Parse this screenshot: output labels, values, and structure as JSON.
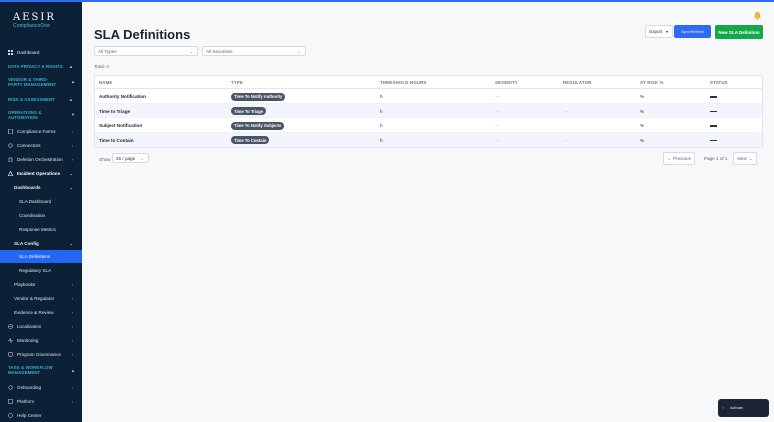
{
  "brand": {
    "name": "AESIR",
    "tagline": "ComplianceOne"
  },
  "sidebar": {
    "top_items": [
      {
        "label": "Dashboard",
        "icon": "grid-icon"
      }
    ],
    "sections": {
      "data_privacy": "DATA PRIVACY & RIGHTS",
      "vendor": "VENDOR & THIRD-PARTY MANAGEMENT",
      "risk": "RISK & ASSESSMENT",
      "operations": "OPERATIONS & AUTOMATION",
      "task": "TASK & WORKFLOW MANAGEMENT"
    },
    "ops_items": {
      "compliance_forms": "Compliance Forms",
      "connectors": "Connectors",
      "deletion": "Deletion Orchestration",
      "incident": "Incident Operations",
      "dashboards": "Dashboards",
      "sla_dashboard": "SLA Dashboard",
      "coordination": "Coordination",
      "response_metrics": "Response Metrics",
      "sla_config": "SLA Config",
      "sla_definitions": "SLA Definitions",
      "regulatory_sla": "Regulatory SLA",
      "playbooks": "Playbooks",
      "vendor_regulator": "Vendor & Regulator",
      "evidence_review": "Evidence & Review",
      "localization": "Localization",
      "monitoring": "Monitoring",
      "program_governance": "Program Governance"
    },
    "bottom_items": {
      "onboarding": "Onboarding",
      "platform": "Platform",
      "help": "Help Center"
    }
  },
  "header": {
    "title": "SLA Definitions",
    "export_label": "Export",
    "sync_label": "Sync/Refresh",
    "new_label": "New SLA Definition"
  },
  "filters": {
    "types": "All Types",
    "securities": "All Securities"
  },
  "total_label": "Total: 4",
  "table": {
    "columns": [
      "NAME",
      "TYPE",
      "THRESHOLD HOURS",
      "SEVERITY",
      "REGULATOR",
      "AT RISK %",
      "STATUS"
    ],
    "rows": [
      {
        "name": "Authority Notification",
        "type": "Time To Notify Authority",
        "threshold": "h",
        "severity": "—",
        "regulator": "",
        "at_risk": "%"
      },
      {
        "name": "Time to Triage",
        "type": "Time To Triage",
        "threshold": "h",
        "severity": "—",
        "regulator": "—",
        "at_risk": "%"
      },
      {
        "name": "Subject Notification",
        "type": "Time To Notify Subjects",
        "threshold": "h",
        "severity": "—",
        "regulator": "",
        "at_risk": "%"
      },
      {
        "name": "Time to Contain",
        "type": "Time To Contain",
        "threshold": "h",
        "severity": "—",
        "regulator": "—",
        "at_risk": "%"
      }
    ]
  },
  "pagination": {
    "show_label": "Show",
    "per_page": "25 / page",
    "prev": "← Previous",
    "info": "Page 1 of 1",
    "next": "Next →"
  },
  "toast": {
    "close": "×",
    "label": "Activate",
    "meta": "···"
  }
}
